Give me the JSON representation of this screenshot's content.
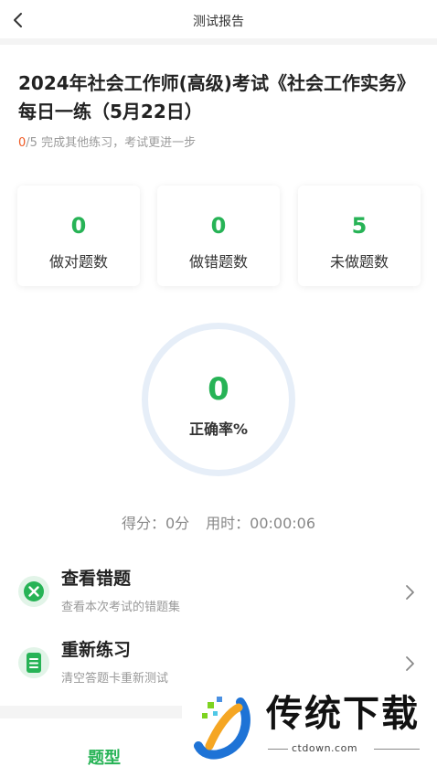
{
  "nav": {
    "title": "测试报告",
    "back_icon": "chevron-left-icon"
  },
  "exam": {
    "title": "2024年社会工作师(高级)考试《社会工作实务》每日一练（5月22日）",
    "progress_done": "0",
    "progress_rest": "/5 完成其他练习，考试更进一步"
  },
  "stats": [
    {
      "value": "0",
      "label": "做对题数"
    },
    {
      "value": "0",
      "label": "做错题数"
    },
    {
      "value": "5",
      "label": "未做题数"
    }
  ],
  "accuracy": {
    "value": "0",
    "label": "正确率%",
    "fraction": 0
  },
  "score": {
    "score_text": "得分：0分",
    "time_text": "用时：00:00:06"
  },
  "actions": [
    {
      "title": "查看错题",
      "subtitle": "查看本次考试的错题集",
      "icon": "close-circle-icon"
    },
    {
      "title": "重新练习",
      "subtitle": "清空答题卡重新测试",
      "icon": "document-icon"
    }
  ],
  "bottom_tab": {
    "label": "题型"
  },
  "watermark": {
    "text": "传统下载",
    "url": "ctdown.com"
  },
  "colors": {
    "accent": "#27b356",
    "progress_done": "#f05a24",
    "ring": "#e6eef8"
  }
}
